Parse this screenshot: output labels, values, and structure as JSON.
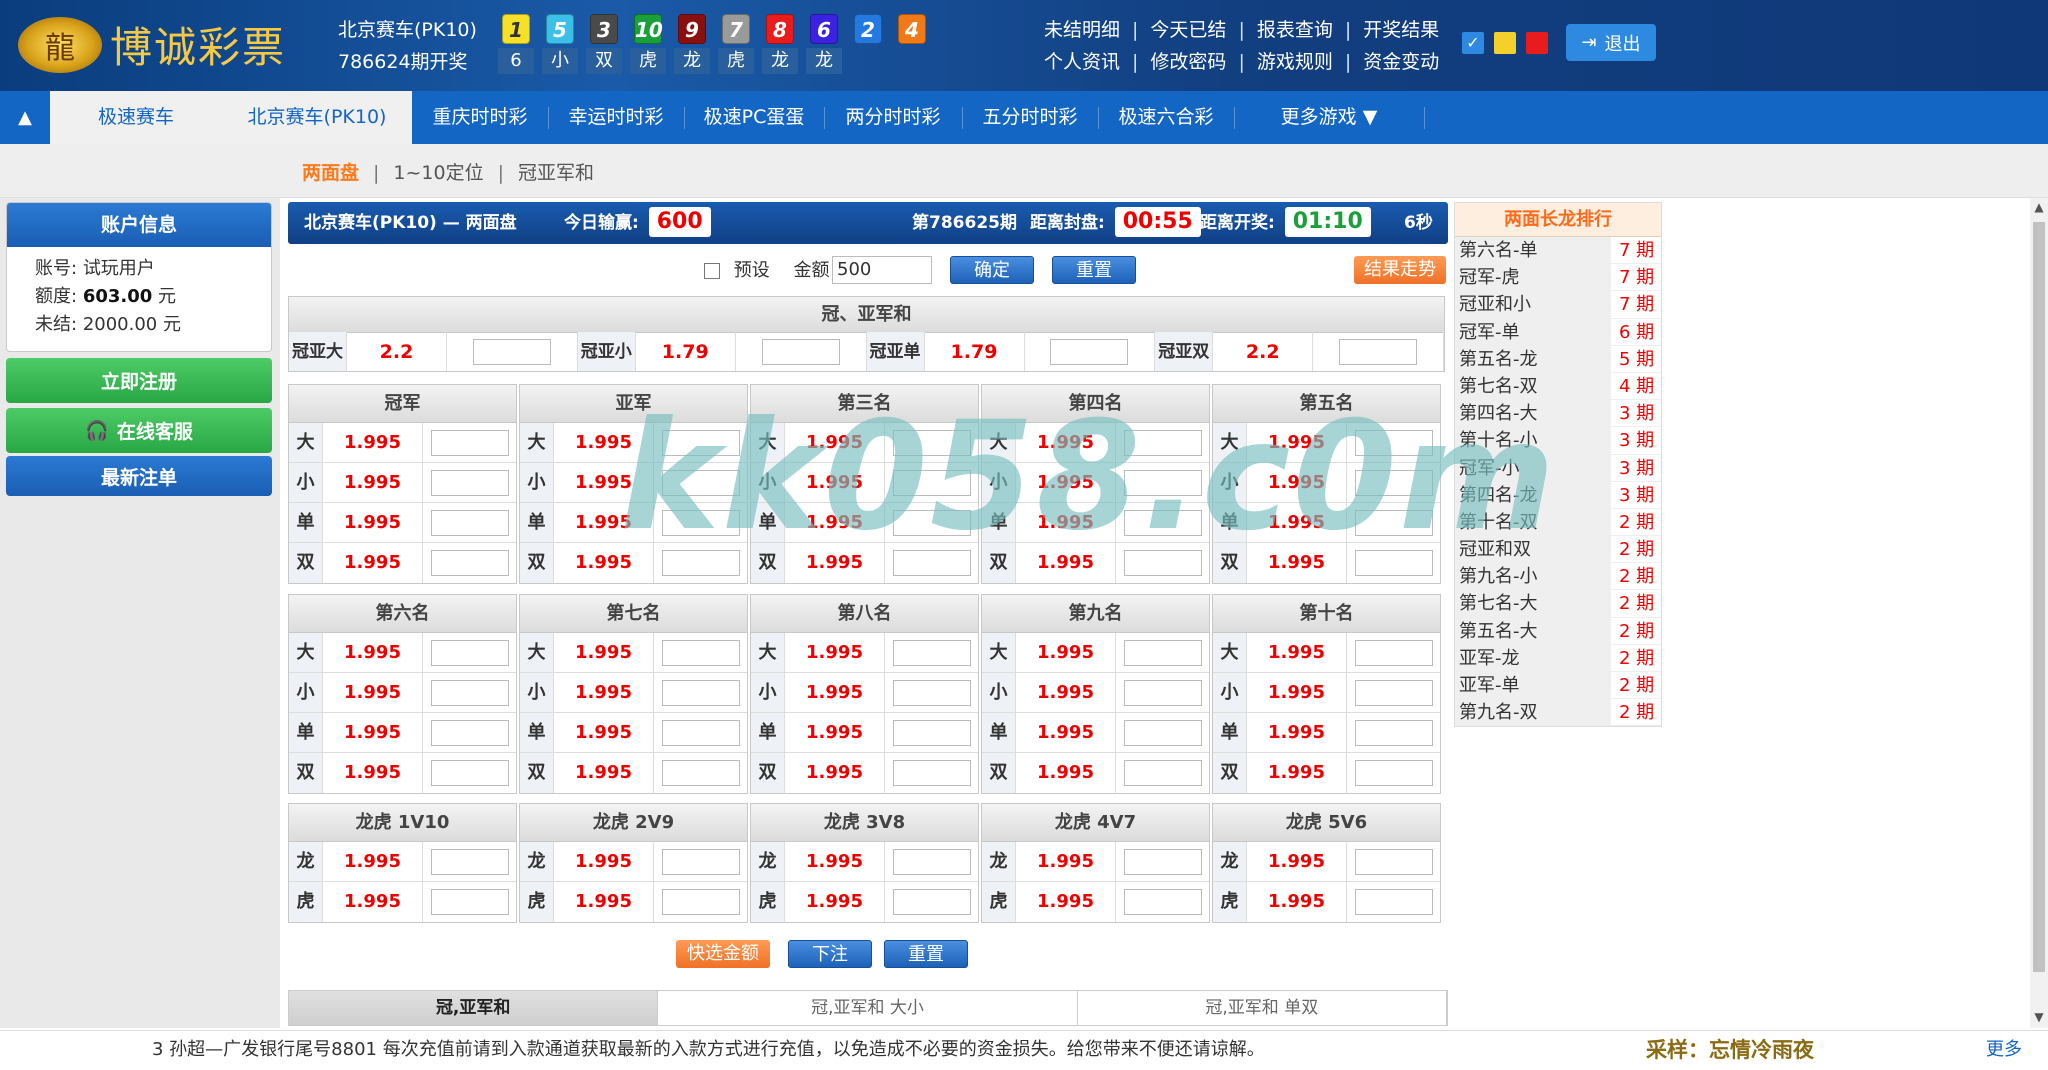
{
  "header": {
    "logo_text": "博诚彩票",
    "game_name": "北京赛车(PK10)",
    "draw_text": "786624期开奖",
    "balls": [
      {
        "num": "1",
        "color": "#f5e12a",
        "text_color": "#333",
        "label": "6"
      },
      {
        "num": "5",
        "color": "#3cc0e8",
        "text_color": "#fff",
        "label": "小"
      },
      {
        "num": "3",
        "color": "#4a4a4a",
        "text_color": "#fff",
        "label": "双"
      },
      {
        "num": "10",
        "color": "#1aa03a",
        "text_color": "#fff",
        "label": "虎"
      },
      {
        "num": "9",
        "color": "#8a1010",
        "text_color": "#fff",
        "label": "龙"
      },
      {
        "num": "7",
        "color": "#9a9a9a",
        "text_color": "#fff",
        "label": "虎"
      },
      {
        "num": "8",
        "color": "#e81c1c",
        "text_color": "#fff",
        "label": "龙"
      },
      {
        "num": "6",
        "color": "#3a22e0",
        "text_color": "#fff",
        "label": "龙"
      },
      {
        "num": "2",
        "color": "#2479e0",
        "text_color": "#fff",
        "label": ""
      },
      {
        "num": "4",
        "color": "#f07a18",
        "text_color": "#fff",
        "label": ""
      }
    ],
    "links_row1": [
      "未结明细",
      "今天已结",
      "报表查询",
      "开奖结果"
    ],
    "links_row2": [
      "个人资讯",
      "修改密码",
      "游戏规则",
      "资金变动"
    ],
    "swatch_colors": [
      "#2e8ae0",
      "#f4d12a",
      "#e81c1c"
    ],
    "logout_label": "退出"
  },
  "nav": {
    "tabs": [
      "极速赛车",
      "北京赛车(PK10)",
      "重庆时时彩",
      "幸运时时彩",
      "极速PC蛋蛋",
      "两分时时彩",
      "五分时时彩",
      "极速六合彩",
      "更多游戏 ▼"
    ],
    "active_index": 1
  },
  "subnav": {
    "items": [
      "两面盘",
      "1~10定位",
      "冠亚军和"
    ],
    "active_index": 0
  },
  "sidebar": {
    "account_title": "账户信息",
    "account_label": "账号:",
    "account_value": "试玩用户",
    "credit_label": "额度:",
    "credit_value": "603.00",
    "credit_unit": "元",
    "unsettled_label": "未结:",
    "unsettled_value": "2000.00 元",
    "register_label": "立即注册",
    "service_label": "在线客服",
    "latest_label": "最新注单"
  },
  "mainbar": {
    "title": "北京赛车(PK10) — 两面盘",
    "today_label": "今日输赢:",
    "today_value": "600",
    "period": "第786625期",
    "close_label": "距离封盘:",
    "close_time": "00:55",
    "open_label": "距离开奖:",
    "open_time": "01:10",
    "seconds": "6秒"
  },
  "controls": {
    "preset_label": "预设",
    "amount_label": "金额",
    "amount_value": "500",
    "confirm": "确定",
    "reset": "重置",
    "trend": "结果走势",
    "quick_amount": "快选金额",
    "place_bet": "下注",
    "reset2": "重置"
  },
  "gyh": {
    "title": "冠、亚军和",
    "cells": [
      {
        "name": "冠亚大",
        "odds": "2.2"
      },
      {
        "name": "冠亚小",
        "odds": "1.79"
      },
      {
        "name": "冠亚单",
        "odds": "1.79"
      },
      {
        "name": "冠亚双",
        "odds": "2.2"
      }
    ]
  },
  "groups1": {
    "titles": [
      "冠军",
      "亚军",
      "第三名",
      "第四名",
      "第五名"
    ],
    "rows": [
      {
        "name": "大",
        "odds": "1.995"
      },
      {
        "name": "小",
        "odds": "1.995"
      },
      {
        "name": "单",
        "odds": "1.995"
      },
      {
        "name": "双",
        "odds": "1.995"
      }
    ]
  },
  "groups2": {
    "titles": [
      "第六名",
      "第七名",
      "第八名",
      "第九名",
      "第十名"
    ],
    "rows": [
      {
        "name": "大",
        "odds": "1.995"
      },
      {
        "name": "小",
        "odds": "1.995"
      },
      {
        "name": "单",
        "odds": "1.995"
      },
      {
        "name": "双",
        "odds": "1.995"
      }
    ]
  },
  "groups3": {
    "titles": [
      "龙虎 1V10",
      "龙虎 2V9",
      "龙虎 3V8",
      "龙虎 4V7",
      "龙虎 5V6"
    ],
    "rows": [
      {
        "name": "龙",
        "odds": "1.995"
      },
      {
        "name": "虎",
        "odds": "1.995"
      }
    ]
  },
  "ranking": {
    "title": "两面长龙排行",
    "items": [
      {
        "name": "第六名-单",
        "value": "7 期"
      },
      {
        "name": "冠军-虎",
        "value": "7 期"
      },
      {
        "name": "冠亚和小",
        "value": "7 期"
      },
      {
        "name": "冠军-单",
        "value": "6 期"
      },
      {
        "name": "第五名-龙",
        "value": "5 期"
      },
      {
        "name": "第七名-双",
        "value": "4 期"
      },
      {
        "name": "第四名-大",
        "value": "3 期"
      },
      {
        "name": "第十名-小",
        "value": "3 期"
      },
      {
        "name": "冠军-小",
        "value": "3 期"
      },
      {
        "name": "第四名-龙",
        "value": "3 期"
      },
      {
        "name": "第十名-双",
        "value": "2 期"
      },
      {
        "name": "冠亚和双",
        "value": "2 期"
      },
      {
        "name": "第九名-小",
        "value": "2 期"
      },
      {
        "name": "第七名-大",
        "value": "2 期"
      },
      {
        "name": "第五名-大",
        "value": "2 期"
      },
      {
        "name": "亚军-龙",
        "value": "2 期"
      },
      {
        "name": "亚军-单",
        "value": "2 期"
      },
      {
        "name": "第九名-双",
        "value": "2 期"
      }
    ]
  },
  "bottom_tabs": [
    "冠,亚军和",
    "冠,亚军和 大小",
    "冠,亚军和 单双"
  ],
  "marquee": {
    "text": "3 孙超—广发银行尾号8801 每次充值前请到入款通道获取最新的入款方式进行充值，以免造成不必要的资金损失。给您带来不便还请谅解。",
    "more": "更多",
    "signature": "采样：忘情冷雨夜"
  },
  "watermark": "kk058.c0m"
}
